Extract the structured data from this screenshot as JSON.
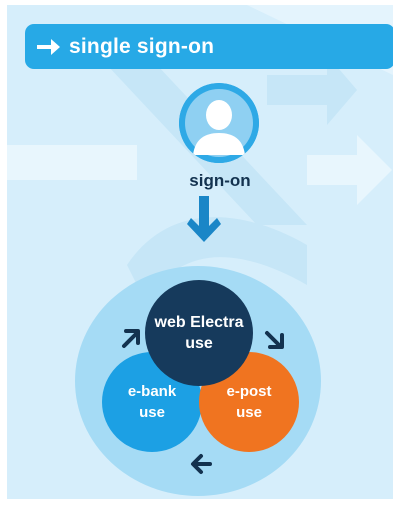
{
  "header": {
    "title": "single sign-on"
  },
  "user": {
    "label": "sign-on"
  },
  "circles": {
    "web": {
      "line1": "web Electra",
      "line2": "use"
    },
    "ebank": {
      "line1": "e-bank",
      "line2": "use"
    },
    "epost": {
      "line1": "e-post",
      "line2": "use"
    }
  },
  "icons": {
    "header_arrow": "arrow-right-icon",
    "user": "user-icon",
    "flow_down": "arrow-down-icon",
    "cycle": [
      "arrow-up-right-icon",
      "arrow-down-right-icon",
      "arrow-left-icon"
    ]
  },
  "colors": {
    "background": "#d6eefb",
    "header": "#27a9e6",
    "web_electra": "#163a5c",
    "e_bank": "#1ca0e4",
    "e_post": "#f07420",
    "ring": "#a5dbf5",
    "arrow": "#13324f"
  }
}
